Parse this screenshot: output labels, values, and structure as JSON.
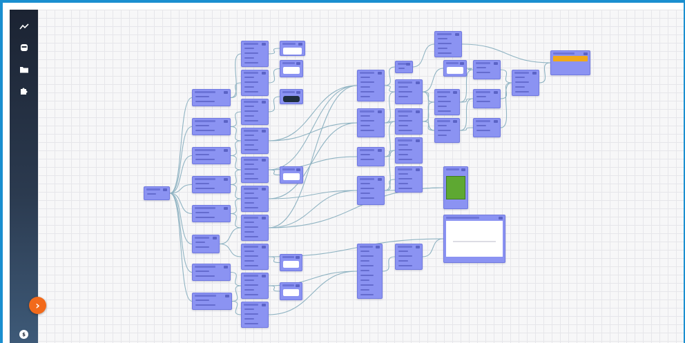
{
  "sidebar": {
    "items": [
      {
        "name": "metrics",
        "icon": "trend-line-icon"
      },
      {
        "name": "store",
        "icon": "database-icon"
      },
      {
        "name": "files",
        "icon": "folder-icon"
      },
      {
        "name": "extensions",
        "icon": "puzzle-piece-icon"
      }
    ],
    "expand_icon": "chevron-right-icon",
    "expand_glyph": "›",
    "info_icon": "dollar-icon",
    "info_glyph": "$"
  },
  "graph": {
    "node_color": "#8b93f2",
    "wire_color": "#8fb3c2",
    "grid_color": "#e6e6ea",
    "accent_color": "#f26a1b",
    "frame_color": "#1a8fd0"
  }
}
